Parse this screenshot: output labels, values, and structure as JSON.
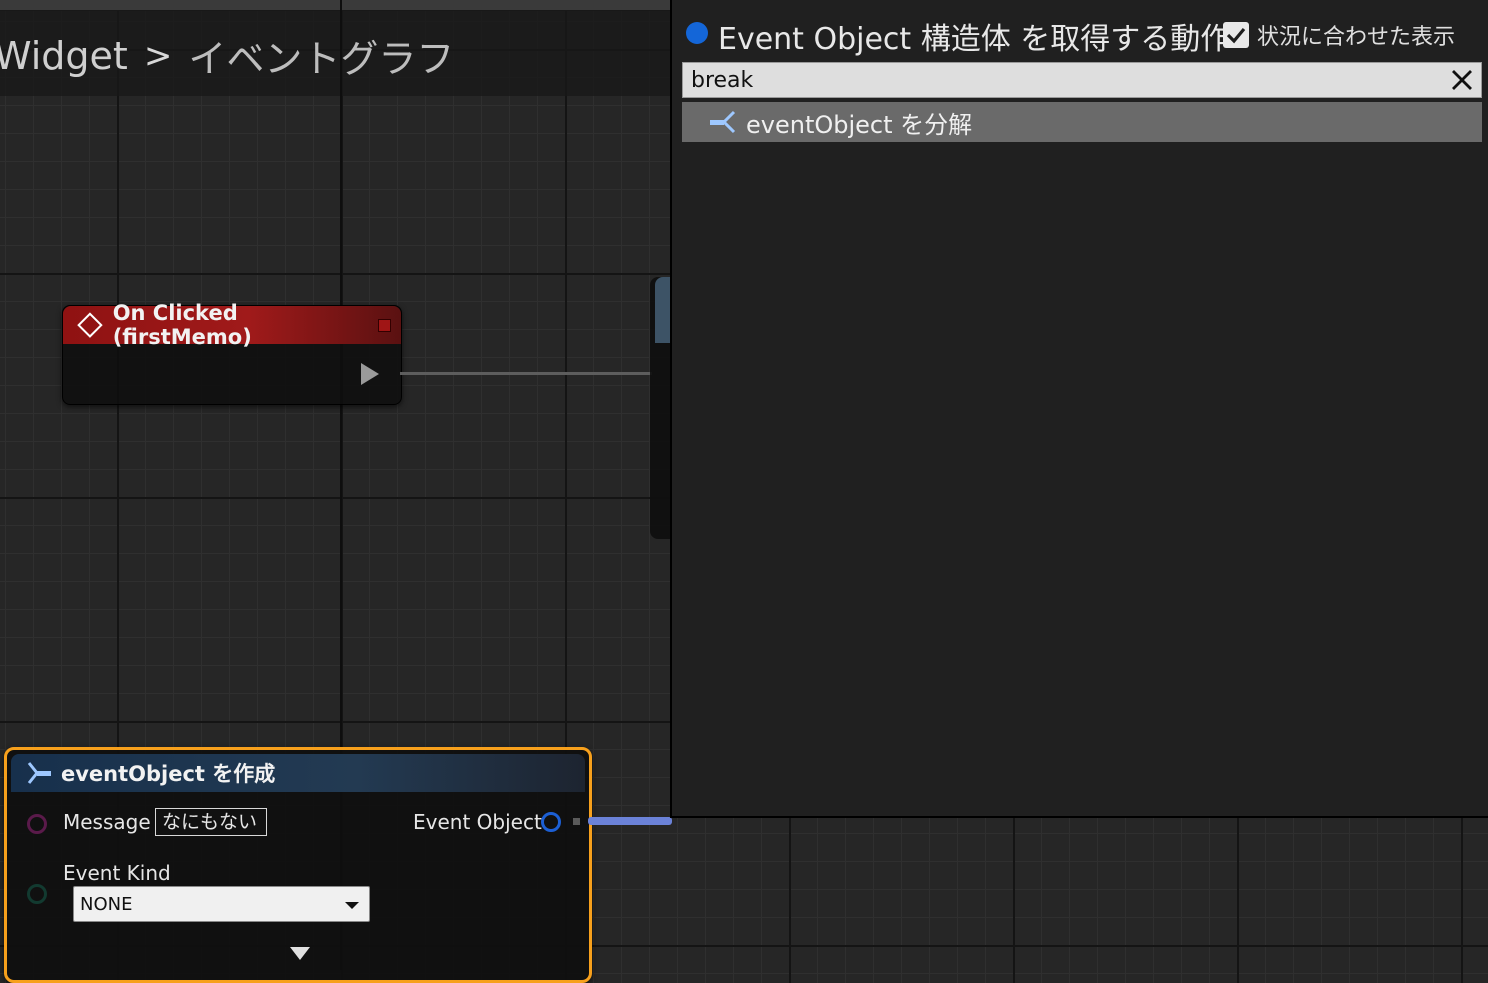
{
  "breadcrumb": {
    "widget": "Widget",
    "separator": ">",
    "graph": "イベントグラフ"
  },
  "nodes": {
    "on_clicked": {
      "title": "On Clicked (firstMemo)"
    },
    "make_event_object": {
      "title": "eventObject を作成",
      "message_label": "Message",
      "message_value": "なにもない",
      "event_object_label": "Event Object",
      "event_kind_label": "Event Kind",
      "event_kind_value": "NONE"
    }
  },
  "action_menu": {
    "title": "Event Object 構造体 を取得する動作",
    "context_sensitive_label": "状況に合わせた表示",
    "context_sensitive_checked": true,
    "search_value": "break",
    "results": [
      {
        "label": "eventObject を分解"
      }
    ]
  },
  "colors": {
    "event_header": "#a01a1a",
    "struct_header": "#233a52",
    "selection_border": "#f7a01c",
    "struct_pin": "#1c5fd4",
    "struct_wire": "#6b82d8",
    "menu_dot": "#1466d8"
  }
}
